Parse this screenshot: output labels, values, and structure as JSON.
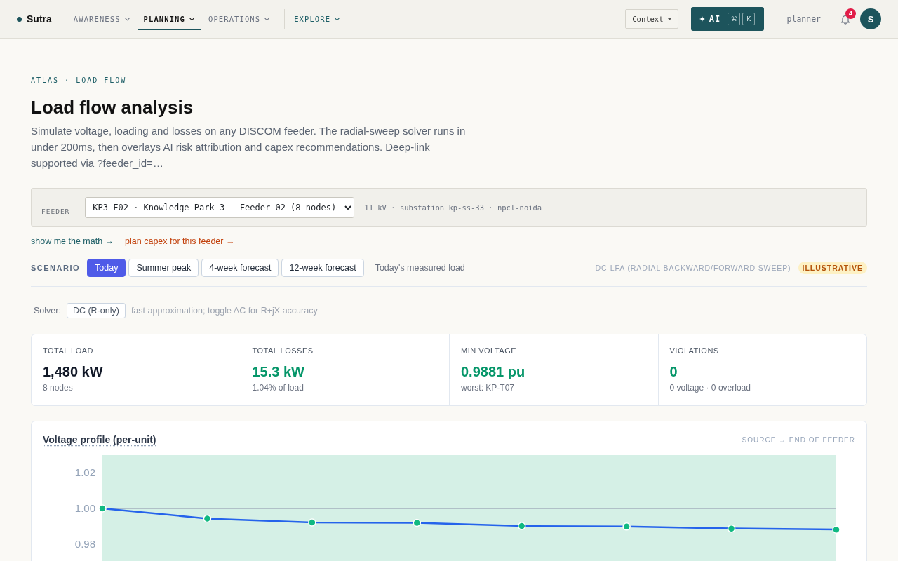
{
  "top_bar": {
    "brand": "Sutra",
    "nav": {
      "primary": [
        {
          "label": "AWARENESS",
          "selected": false
        },
        {
          "label": "PLANNING",
          "selected": true
        },
        {
          "label": "OPERATIONS",
          "selected": false
        }
      ],
      "secondary": [
        {
          "label": "EXPLORE",
          "selected": false
        }
      ]
    },
    "context_menu": "Context",
    "ai_button": {
      "label": "AI",
      "keys": [
        "⌘",
        "K"
      ]
    },
    "role": "planner",
    "notification_count": "4",
    "avatar_initial": "S"
  },
  "breadcrumb": "ATLAS · LOAD FLOW",
  "title": "Load flow analysis",
  "description": "Simulate voltage, loading and losses on any DISCOM feeder. The radial-sweep solver runs in under 200ms, then overlays AI risk attribution and capex recommendations. Deep-link supported via ?feeder_id=…",
  "feeder": {
    "label": "FEEDER",
    "value": "KP3-F02 · Knowledge Park 3 — Feeder 02 (8 nodes)",
    "meta": "11 kV · substation kp-ss-33 · npcl-noida"
  },
  "links": [
    {
      "label": "show me the math →",
      "kind": "explain"
    },
    {
      "label": "plan capex for this feeder →",
      "kind": "action"
    }
  ],
  "scenario": {
    "label": "SCENARIO",
    "options": [
      {
        "label": "Today",
        "selected": true
      },
      {
        "label": "Summer peak",
        "selected": false
      },
      {
        "label": "4-week forecast",
        "selected": false
      },
      {
        "label": "12-week forecast",
        "selected": false
      }
    ],
    "description": "Today's measured load",
    "method": "DC-LFA (RADIAL BACKWARD/FORWARD SWEEP)",
    "badge": "ILLUSTRATIVE"
  },
  "solver": {
    "label": "Solver:",
    "mode": "DC (R-only)",
    "note": "fast approximation; toggle AC for R+jX accuracy"
  },
  "stats": [
    {
      "label": "TOTAL LOAD",
      "value": "1,480 kW",
      "positive": false,
      "detail": "8 nodes"
    },
    {
      "label": "TOTAL",
      "defined_term": "LOSSES",
      "value": "15.3 kW",
      "positive": true,
      "detail": "1.04% of load"
    },
    {
      "label": "MIN VOLTAGE",
      "value": "0.9881 pu",
      "positive": true,
      "detail": "worst: KP-T07"
    },
    {
      "label": "VIOLATIONS",
      "value": "0",
      "positive": true,
      "detail": "0 voltage · 0 overload"
    }
  ],
  "voltage_profile": {
    "title_defined": true,
    "direction_note": "SOURCE → END OF FEEDER",
    "chart_data": {
      "type": "line",
      "title": "Voltage profile (per-unit)",
      "series": [
        {
          "color": "#2563eb",
          "marker": "circle",
          "values": [
            1.0,
            0.9943,
            0.9921,
            0.9919,
            0.9901,
            0.9898,
            0.9887,
            0.9881
          ]
        }
      ],
      "ylim": [
        0.97,
        1.03
      ],
      "yticks": [
        {
          "value": 0.98,
          "label": "0.98"
        },
        {
          "value": 1.0,
          "label": "1.00"
        },
        {
          "value": 1.02,
          "label": "1.02"
        }
      ]
    }
  }
}
